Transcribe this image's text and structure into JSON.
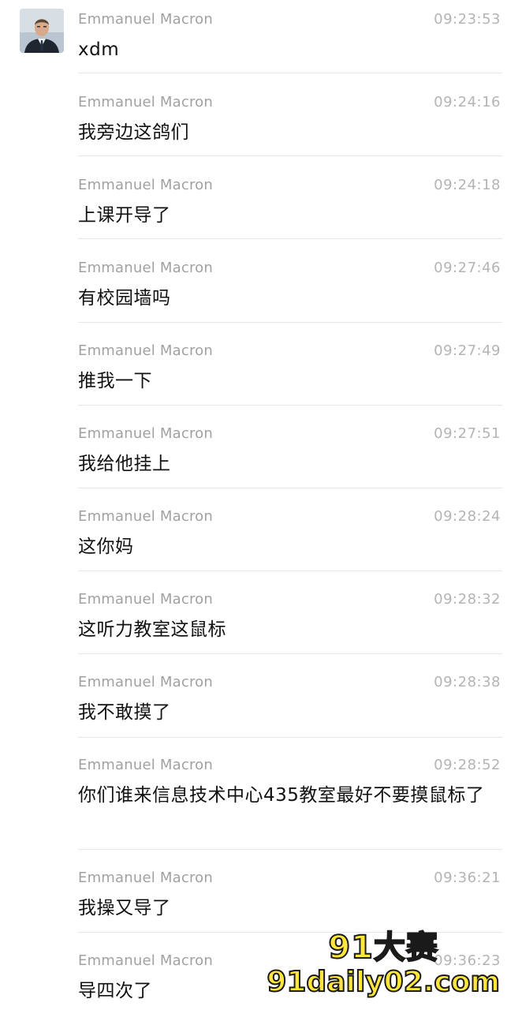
{
  "chat": {
    "messages": [
      {
        "sender": "Emmanuel Macron",
        "time": "09:23:53",
        "text": "xdm"
      },
      {
        "sender": "Emmanuel Macron",
        "time": "09:24:16",
        "text": "我旁边这鸽们"
      },
      {
        "sender": "Emmanuel Macron",
        "time": "09:24:18",
        "text": "上课开导了"
      },
      {
        "sender": "Emmanuel Macron",
        "time": "09:27:46",
        "text": "有校园墙吗"
      },
      {
        "sender": "Emmanuel Macron",
        "time": "09:27:49",
        "text": "推我一下"
      },
      {
        "sender": "Emmanuel Macron",
        "time": "09:27:51",
        "text": "我给他挂上"
      },
      {
        "sender": "Emmanuel Macron",
        "time": "09:28:24",
        "text": "这你妈"
      },
      {
        "sender": "Emmanuel Macron",
        "time": "09:28:32",
        "text": "这听力教室这鼠标"
      },
      {
        "sender": "Emmanuel Macron",
        "time": "09:28:38",
        "text": "我不敢摸了"
      },
      {
        "sender": "Emmanuel Macron",
        "time": "09:28:52",
        "text": "你们谁来信息技术中心435教室最好不要摸鼠标了"
      },
      {
        "sender": "Emmanuel Macron",
        "time": "09:36:21",
        "text": "我操又导了"
      },
      {
        "sender": "Emmanuel Macron",
        "time": "09:36:23",
        "text": "导四次了"
      }
    ]
  },
  "watermark": {
    "line1": "91大赛",
    "line2": "91daily02.com"
  },
  "colors": {
    "sender": "#a1a1a1",
    "time": "#b4b4b4",
    "text": "#111111",
    "divider": "#e7e7e7",
    "watermark_fill": "#ffe63a"
  },
  "icons": {
    "avatar": "user-avatar-photo"
  }
}
